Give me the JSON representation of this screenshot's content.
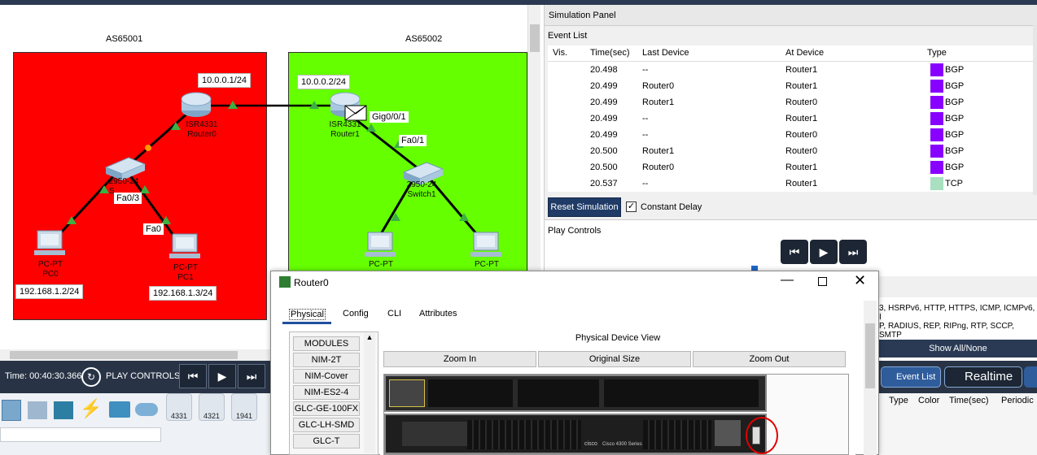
{
  "workspace": {
    "as_left": "AS65001",
    "as_right": "AS65002",
    "ip_router0": "10.0.0.1/24",
    "ip_router1": "10.0.0.2/24",
    "router0_model": "ISR4331",
    "router0_name": "Router0",
    "router1_model": "ISR4331",
    "router1_name": "Router1",
    "port_gig": "Gig0/0/1",
    "port_fa01": "Fa0/1",
    "port_fa03": "Fa0/3",
    "port_fa0": "Fa0",
    "switch0_model": "2950-24",
    "switch0_name": "S",
    "switch1_model": "2950-24",
    "switch1_name": "Switch1",
    "pc0_model": "PC-PT",
    "pc0_name": "PC0",
    "pc1_model": "PC-PT",
    "pc1_name": "PC1",
    "pc2_model": "PC-PT",
    "pc3_model": "PC-PT",
    "ip_pc0": "192.168.1.2/24",
    "ip_pc1": "192.168.1.3/24",
    "colors": {
      "as_left_bg": "#ff0000",
      "as_right_bg": "#66ff00"
    }
  },
  "timebar": {
    "time": "Time: 00:40:30.366",
    "play_controls": "PLAY CONTROLS:"
  },
  "palette": {
    "devices": [
      "4331",
      "4321",
      "1941"
    ]
  },
  "sim_panel": {
    "title": "Simulation Panel",
    "event_list": "Event List",
    "columns": [
      "Vis.",
      "Time(sec)",
      "Last Device",
      "At Device",
      "Type"
    ],
    "events": [
      {
        "time": "20.498",
        "last": "--",
        "at": "Router1",
        "type": "BGP",
        "color": "#8800ff"
      },
      {
        "time": "20.499",
        "last": "Router0",
        "at": "Router1",
        "type": "BGP",
        "color": "#8800ff"
      },
      {
        "time": "20.499",
        "last": "Router1",
        "at": "Router0",
        "type": "BGP",
        "color": "#8800ff"
      },
      {
        "time": "20.499",
        "last": "--",
        "at": "Router1",
        "type": "BGP",
        "color": "#8800ff"
      },
      {
        "time": "20.499",
        "last": "--",
        "at": "Router0",
        "type": "BGP",
        "color": "#8800ff"
      },
      {
        "time": "20.500",
        "last": "Router1",
        "at": "Router0",
        "type": "BGP",
        "color": "#8800ff"
      },
      {
        "time": "20.500",
        "last": "Router0",
        "at": "Router1",
        "type": "BGP",
        "color": "#8800ff"
      },
      {
        "time": "20.537",
        "last": "--",
        "at": "Router1",
        "type": "TCP",
        "color": "#a8e0c0"
      }
    ],
    "reset_label": "Reset Simulation",
    "constant_delay_label": "Constant Delay",
    "play_controls_label": "Play Controls",
    "protocols_line1": "3, HSRPv6, HTTP, HTTPS, ICMP, ICMPv6, I",
    "protocols_line2": "P, RADIUS, REP, RIPng, RTP, SCCP, SMTP",
    "show_all": "Show All/None"
  },
  "dialog": {
    "title": "Router0",
    "tabs": [
      "Physical",
      "Config",
      "CLI",
      "Attributes"
    ],
    "modules": [
      "MODULES",
      "NIM-2T",
      "NIM-Cover",
      "NIM-ES2-4",
      "GLC-GE-100FX",
      "GLC-LH-SMD",
      "GLC-T"
    ],
    "view_title": "Physical Device View",
    "zoom_in": "Zoom In",
    "original_size": "Original Size",
    "zoom_out": "Zoom Out",
    "brand": "cisco",
    "series": "Cisco 4300 Series"
  },
  "event_bar": {
    "event_list_btn": "Event List",
    "realtime_btn": "Realtime",
    "columns": [
      "Type",
      "Color",
      "Time(sec)",
      "Periodic"
    ]
  }
}
